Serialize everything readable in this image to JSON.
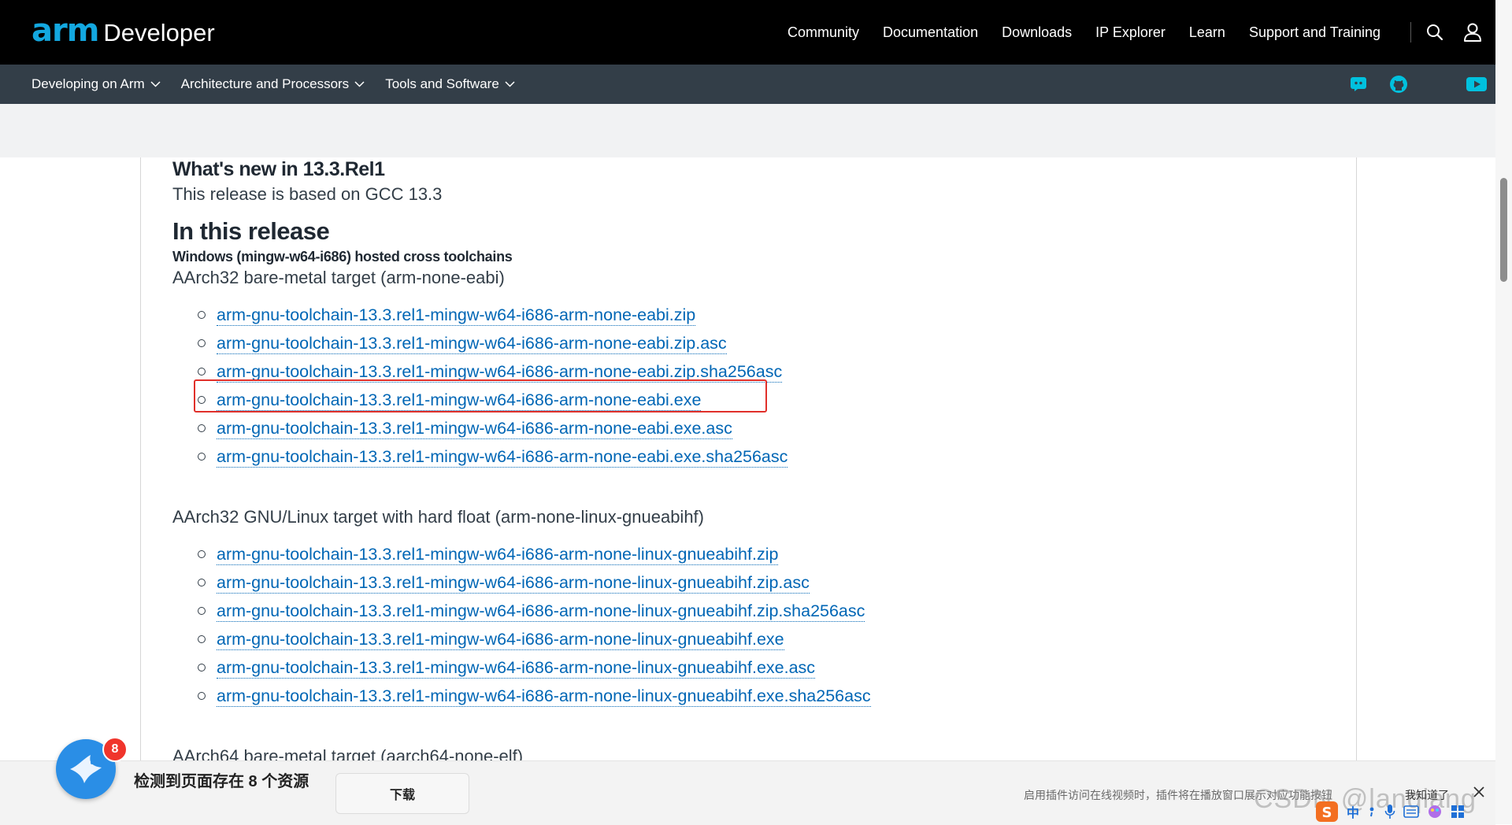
{
  "header": {
    "logo_arm": "arm",
    "logo_developer": "Developer",
    "nav": [
      "Community",
      "Documentation",
      "Downloads",
      "IP Explorer",
      "Learn",
      "Support and Training"
    ]
  },
  "subnav": {
    "items": [
      "Developing on Arm",
      "Architecture and Processors",
      "Tools and Software"
    ]
  },
  "content": {
    "whats_new_title": "What's new in 13.3.Rel1",
    "based_on": "This release is based on GCC 13.3",
    "in_this_release": "In this release",
    "host_heading": "Windows (mingw-w64-i686) hosted cross toolchains",
    "sections": [
      {
        "title": "AArch32 bare-metal target (arm-none-eabi)",
        "files": [
          "arm-gnu-toolchain-13.3.rel1-mingw-w64-i686-arm-none-eabi.zip",
          "arm-gnu-toolchain-13.3.rel1-mingw-w64-i686-arm-none-eabi.zip.asc",
          "arm-gnu-toolchain-13.3.rel1-mingw-w64-i686-arm-none-eabi.zip.sha256asc",
          "arm-gnu-toolchain-13.3.rel1-mingw-w64-i686-arm-none-eabi.exe",
          "arm-gnu-toolchain-13.3.rel1-mingw-w64-i686-arm-none-eabi.exe.asc",
          "arm-gnu-toolchain-13.3.rel1-mingw-w64-i686-arm-none-eabi.exe.sha256asc"
        ]
      },
      {
        "title": "AArch32 GNU/Linux target with hard float (arm-none-linux-gnueabihf)",
        "files": [
          "arm-gnu-toolchain-13.3.rel1-mingw-w64-i686-arm-none-linux-gnueabihf.zip",
          "arm-gnu-toolchain-13.3.rel1-mingw-w64-i686-arm-none-linux-gnueabihf.zip.asc",
          "arm-gnu-toolchain-13.3.rel1-mingw-w64-i686-arm-none-linux-gnueabihf.zip.sha256asc",
          "arm-gnu-toolchain-13.3.rel1-mingw-w64-i686-arm-none-linux-gnueabihf.exe",
          "arm-gnu-toolchain-13.3.rel1-mingw-w64-i686-arm-none-linux-gnueabihf.exe.asc",
          "arm-gnu-toolchain-13.3.rel1-mingw-w64-i686-arm-none-linux-gnueabihf.exe.sha256asc"
        ]
      },
      {
        "title": "AArch64 bare-metal target (aarch64-none-elf)",
        "files": []
      }
    ]
  },
  "download_bar": {
    "badge_count": "8",
    "message": "检测到页面存在 8 个资源",
    "button": "下载",
    "hint": "启用插件访问在线视频时，插件将在播放窗口展示对应功能按钮",
    "dismiss": "我知道了"
  },
  "watermark": "CSDN @lanqiang",
  "ime": {
    "lang": "中"
  },
  "colors": {
    "link": "#0066b5",
    "highlight_box": "#e0302a",
    "brand_blue": "#13a8e0",
    "social_icon": "#00c1de"
  }
}
